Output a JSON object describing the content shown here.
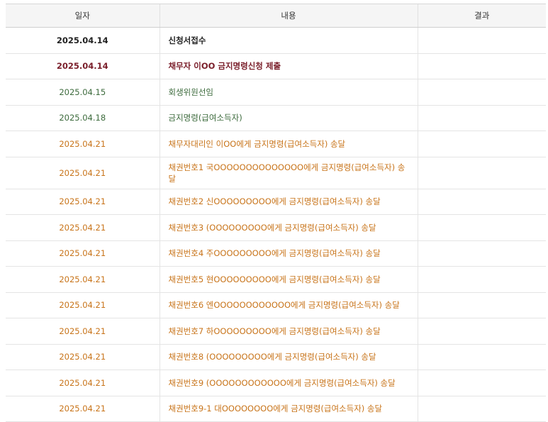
{
  "headers": {
    "date": "일자",
    "content": "내용",
    "result": "결과"
  },
  "colors": {
    "black": "#222222",
    "maroon": "#7a1e2a",
    "green": "#3d6b3d",
    "orange": "#c8741a"
  },
  "rows": [
    {
      "date": "2025.04.14",
      "content": "신청서접수",
      "result": "",
      "color": "#222222"
    },
    {
      "date": "2025.04.14",
      "content": "채무자 이OO 금지명령신청 제출",
      "result": "",
      "color": "#7a1e2a"
    },
    {
      "date": "2025.04.15",
      "content": "회생위원선임",
      "result": "",
      "color": "#3d6b3d"
    },
    {
      "date": "2025.04.18",
      "content": "금지명령(급여소득자)",
      "result": "",
      "color": "#3d6b3d"
    },
    {
      "date": "2025.04.21",
      "content": "채무자대리인 이OO에게 금지명령(급여소득자) 송달",
      "result": "",
      "color": "#c8741a"
    },
    {
      "date": "2025.04.21",
      "content": "채권번호1 국OOOOOOOOOOOOOO에게 금지명령(급여소득자) 송달",
      "result": "",
      "color": "#c8741a"
    },
    {
      "date": "2025.04.21",
      "content": "채권번호2 신OOOOOOOOO에게 금지명령(급여소득자) 송달",
      "result": "",
      "color": "#c8741a"
    },
    {
      "date": "2025.04.21",
      "content": "채권번호3 (OOOOOOOOO에게 금지명령(급여소득자) 송달",
      "result": "",
      "color": "#c8741a"
    },
    {
      "date": "2025.04.21",
      "content": "채권번호4 주OOOOOOOOO에게 금지명령(급여소득자) 송달",
      "result": "",
      "color": "#c8741a"
    },
    {
      "date": "2025.04.21",
      "content": "채권번호5 현OOOOOOOOO에게 금지명령(급여소득자) 송달",
      "result": "",
      "color": "#c8741a"
    },
    {
      "date": "2025.04.21",
      "content": "채권번호6 엔OOOOOOOOOOOO에게 금지명령(급여소득자) 송달",
      "result": "",
      "color": "#c8741a"
    },
    {
      "date": "2025.04.21",
      "content": "채권번호7 하OOOOOOOOO에게 금지명령(급여소득자) 송달",
      "result": "",
      "color": "#c8741a"
    },
    {
      "date": "2025.04.21",
      "content": "채권번호8 (OOOOOOOOO에게 금지명령(급여소득자) 송달",
      "result": "",
      "color": "#c8741a"
    },
    {
      "date": "2025.04.21",
      "content": "채권번호9 (OOOOOOOOOOOO에게 금지명령(급여소득자) 송달",
      "result": "",
      "color": "#c8741a"
    },
    {
      "date": "2025.04.21",
      "content": "채권번호9-1 대OOOOOOOO에게 금지명령(급여소득자) 송달",
      "result": "",
      "color": "#c8741a"
    }
  ]
}
